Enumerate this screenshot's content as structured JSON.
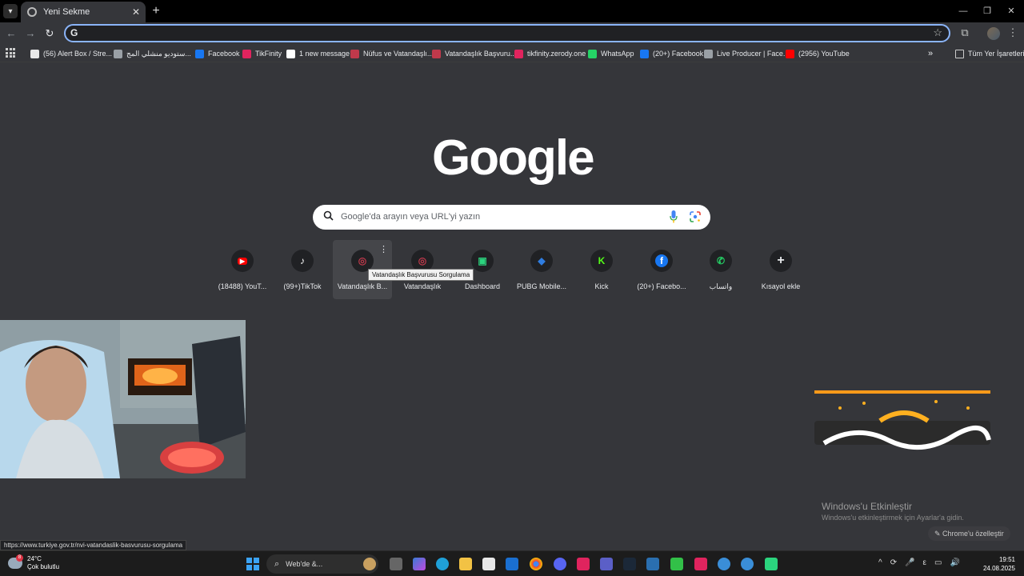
{
  "tab": {
    "title": "Yeni Sekme",
    "close": "✕",
    "new_tab": "+"
  },
  "window_controls": {
    "minimize": "—",
    "restore": "❐",
    "close": "✕"
  },
  "toolbar": {
    "back": "←",
    "forward": "→",
    "reload": "↻",
    "omnibox_icon": "G",
    "omnibox_value": "",
    "star": "☆",
    "extensions": "⧉",
    "menu": "⋮"
  },
  "bookmarks": [
    {
      "label": "(56) Alert Box / Stre...",
      "icon_color": "#e8e8e8"
    },
    {
      "label": "ستوديو منشلي المج...",
      "icon_color": "#9aa0a6"
    },
    {
      "label": "Facebook",
      "icon_color": "#1877f2"
    },
    {
      "label": "TikFinity",
      "icon_color": "#e0245e"
    },
    {
      "label": "1 new message",
      "icon_color": "#ffffff"
    },
    {
      "label": "Nüfus ve Vatandaşlı...",
      "icon_color": "#c0394b"
    },
    {
      "label": "Vatandaşlık Başvuru...",
      "icon_color": "#c0394b"
    },
    {
      "label": "tikfinity.zerody.one",
      "icon_color": "#e0245e"
    },
    {
      "label": "WhatsApp",
      "icon_color": "#25d366"
    },
    {
      "label": "(20+) Facebook",
      "icon_color": "#1877f2"
    },
    {
      "label": "Live Producer | Face...",
      "icon_color": "#9aa0a6"
    },
    {
      "label": "(2956) YouTube",
      "icon_color": "#ff0000"
    }
  ],
  "bookmarks_overflow": "»",
  "all_bookmarks": "Tüm Yer İşaretleri",
  "google_logo": "Google",
  "search": {
    "placeholder": "Google'da arayın veya URL'yi yazın"
  },
  "shortcuts": [
    {
      "label": "(18488) YouT...",
      "icon": "youtube-icon",
      "color": "#ff0000"
    },
    {
      "label": "(99+)TikTok",
      "icon": "tiktok-icon",
      "color": "#000000"
    },
    {
      "label": "Vatandaşlık B...",
      "icon": "vatandaslik-icon",
      "color": "#c0394b"
    },
    {
      "label": "Vatandaşlık",
      "icon": "vatandaslik-icon",
      "color": "#c0394b"
    },
    {
      "label": "Dashboard",
      "icon": "dashboard-icon",
      "color": "#2bd47e"
    },
    {
      "label": "PUBG Mobile...",
      "icon": "pubg-icon",
      "color": "#2f7de1"
    },
    {
      "label": "Kick",
      "icon": "kick-icon",
      "color": "#53fc18"
    },
    {
      "label": "(20+) Facebo...",
      "icon": "facebook-icon",
      "color": "#1877f2"
    },
    {
      "label": "واتساب",
      "icon": "whatsapp-icon",
      "color": "#25d366"
    },
    {
      "label": "Kısayol ekle",
      "icon": "plus-icon",
      "color": "#e8eaed"
    }
  ],
  "tooltip": "Vatandaşlık Başvurusu Sorgulama",
  "activate_windows": {
    "title": "Windows'u Etkinleştir",
    "subtitle": "Windows'u etkinleştirmek için Ayarlar'a gidin."
  },
  "customize_chrome": "Chrome'u özelleştir",
  "status_url": "https://www.turkiye.gov.tr/nvi-vatandaslik-basvurusu-sorgulama",
  "taskbar": {
    "weather_temp": "24°C",
    "weather_desc": "Çok bulutlu",
    "weather_badge": "8",
    "search_text": "Web'de &...",
    "clock_time": "19:51",
    "clock_date": "24.08.2025",
    "tray": [
      "^",
      "⟳",
      "🎤",
      "ε",
      "▭",
      "🔊"
    ]
  }
}
